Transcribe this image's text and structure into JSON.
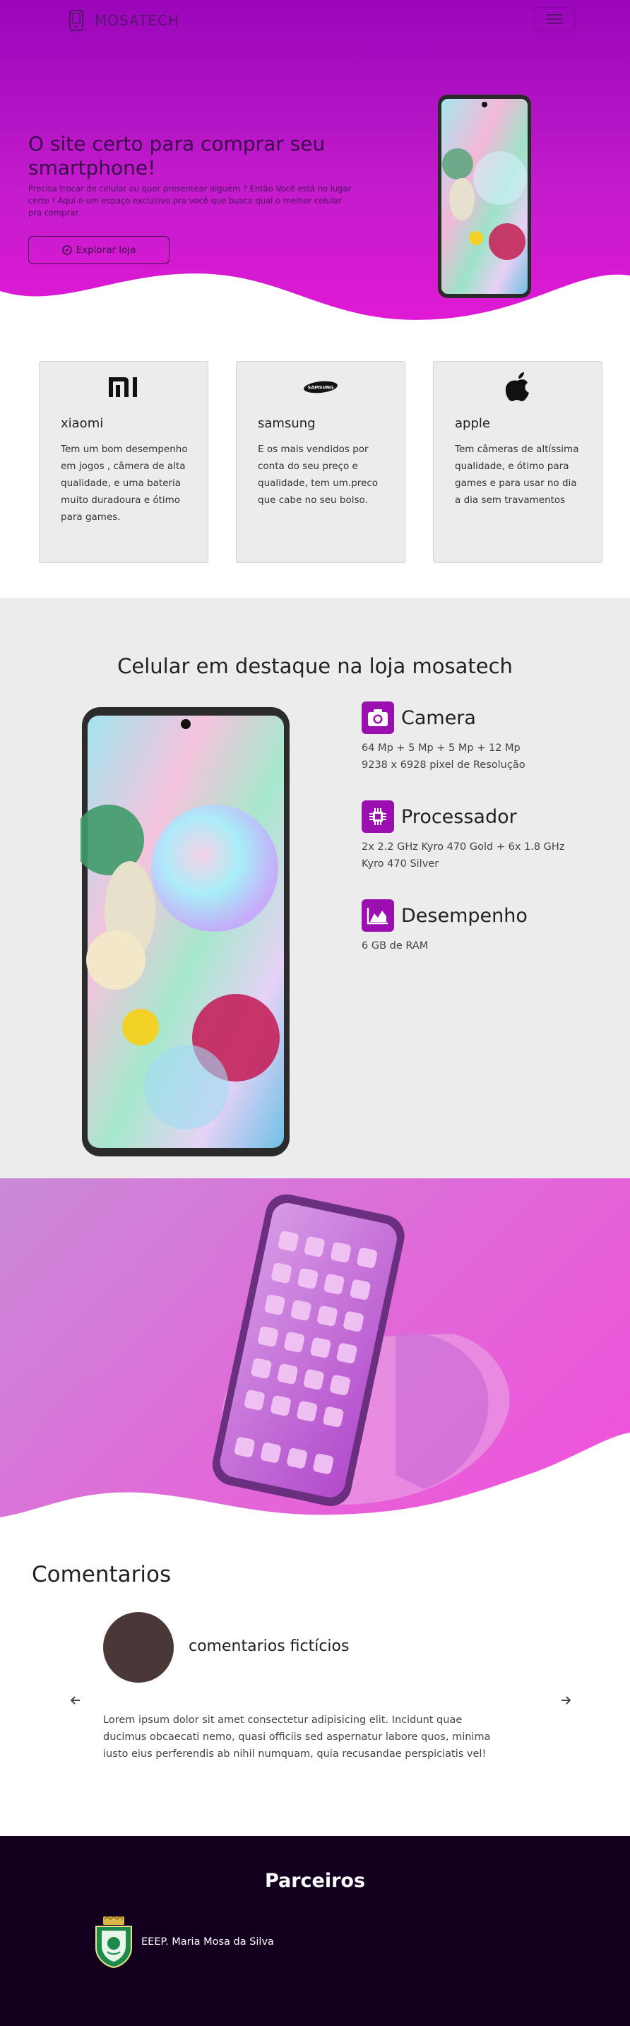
{
  "navbar": {
    "brand_name": "MOSATECH",
    "menu_icon": "hamburger-icon"
  },
  "hero": {
    "title": "O site certo para comprar seu smartphone!",
    "description": "Precisa trocar de celular ou quer presentear alguém ? Então Você está no lugar certo ! Aqui é um espaço exclusivo pra você que busca qual o melhor celular pra comprar.",
    "button_label": "Explorar loja",
    "button_icon": "compass-icon"
  },
  "brands": [
    {
      "name": "xiaomi",
      "logo_text": "mi",
      "description": "Tem um bom desempenho em jogos , câmera de alta qualidade, e uma bateria muito duradoura e ótimo para games."
    },
    {
      "name": "samsung",
      "logo_text": "SAMSUNG",
      "description": "E os mais vendidos por conta do seu preço e qualidade, tem um.preco que cabe no seu bolso."
    },
    {
      "name": "apple",
      "logo_text": "",
      "description": "Tem câmeras de altíssima qualidade, e ótimo para games e para usar no dia a dia sem travamentos"
    }
  ],
  "feature": {
    "title": "Celular em destaque na loja mosatech",
    "specs": [
      {
        "icon": "camera-icon",
        "title": "Camera",
        "lines": [
          "64 Mp + 5 Mp + 5 Mp + 12 Mp",
          "9238 x 6928 pixel de Resolução"
        ]
      },
      {
        "icon": "cpu-icon",
        "title": "Processador",
        "lines": [
          "2x 2.2 GHz Kyro 470 Gold + 6x 1.8 GHz",
          "Kyro 470 Silver"
        ]
      },
      {
        "icon": "chart-area-icon",
        "title": "Desempenho",
        "lines": [
          "6 GB de RAM"
        ]
      }
    ]
  },
  "comments": {
    "title": "Comentarios",
    "author": "comentarios fictícios",
    "text": "Lorem ipsum dolor sit amet consectetur adipisicing elit. Incidunt quae ducimus obcaecati nemo, quasi officiis sed aspernatur labore quos, minima iusto eius perferendis ab nihil numquam, quia recusandae perspiciatis vel!",
    "prev_icon": "arrow-left-icon",
    "next_icon": "arrow-right-icon"
  },
  "footer": {
    "title": "Parceiros",
    "partner_name": "EEEP. Maria Mosa da Silva"
  },
  "colors": {
    "primary": "#9b0fb0",
    "hero_top": "#9a06ba",
    "hero_bottom": "#e21ad6",
    "footer_bg": "#12001e",
    "section_gray": "#ececec"
  }
}
